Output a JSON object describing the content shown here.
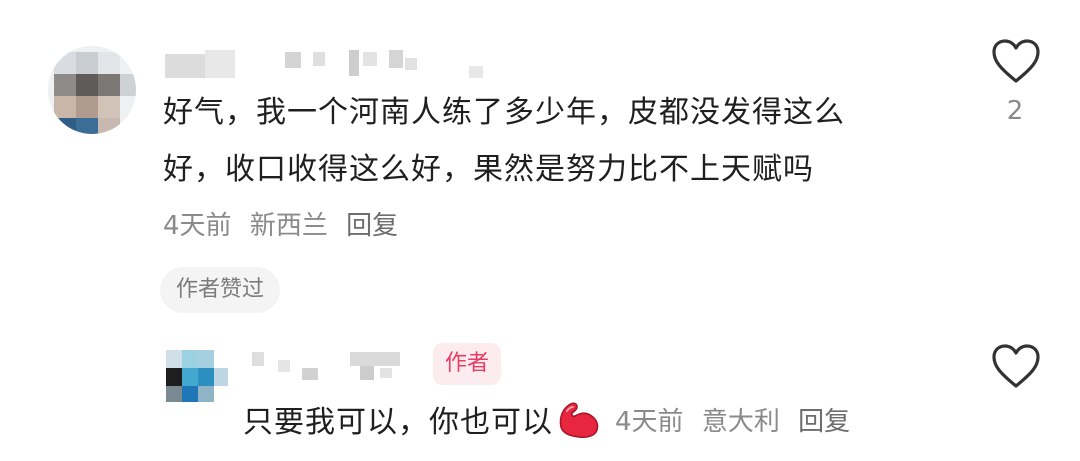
{
  "comment": {
    "text_line1": "好气，我一个河南人练了多少年，皮都没发得这么",
    "text_line2": "好，收口收得这么好，果然是努力比不上天赋吗",
    "time": "4天前",
    "location": "新西兰",
    "reply_label": "回复",
    "author_liked_badge": "作者赞过",
    "like_count": "2"
  },
  "reply": {
    "author_badge": "作者",
    "text": "只要我可以，你也可以",
    "emoji": "muscle-emoji",
    "time": "4天前",
    "location": "意大利",
    "reply_label": "回复"
  },
  "colors": {
    "author_badge_text": "#e83d63",
    "author_badge_bg": "#fdecef",
    "meta_gray": "#8a8a8a",
    "emoji_red": "#e8263f"
  }
}
